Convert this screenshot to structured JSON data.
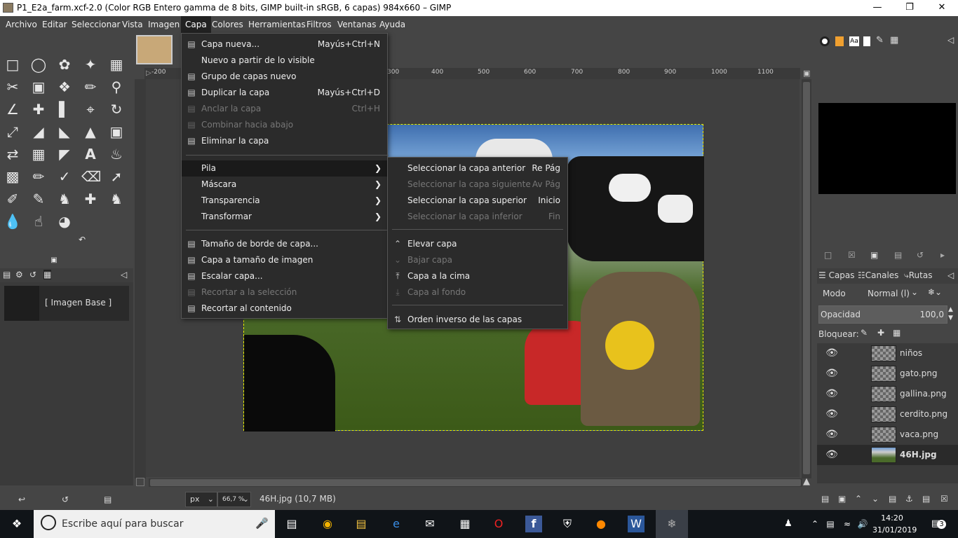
{
  "window": {
    "title": "P1_E2a_farm.xcf-2.0 (Color RGB Entero gamma de 8 bits, GIMP built-in sRGB, 6 capas) 984x660 – GIMP"
  },
  "menubar": [
    "Archivo",
    "Editar",
    "Seleccionar",
    "Vista",
    "Imagen",
    "Capa",
    "Colores",
    "Herramientas",
    "Filtros",
    "Ventanas",
    "Ayuda"
  ],
  "capa_menu": {
    "items": [
      {
        "label": "Capa nueva...",
        "shortcut": "Mayús+Ctrl+N",
        "icon": "new-layer-icon",
        "disabled": false
      },
      {
        "label": "Nuevo a partir de lo visible",
        "shortcut": "",
        "icon": "",
        "disabled": false
      },
      {
        "label": "Grupo de capas nuevo",
        "shortcut": "",
        "icon": "layer-group-icon",
        "disabled": false
      },
      {
        "label": "Duplicar la capa",
        "shortcut": "Mayús+Ctrl+D",
        "icon": "duplicate-icon",
        "disabled": false
      },
      {
        "label": "Anclar la capa",
        "shortcut": "Ctrl+H",
        "icon": "anchor-icon",
        "disabled": true
      },
      {
        "label": "Combinar hacia abajo",
        "shortcut": "",
        "icon": "merge-down-icon",
        "disabled": true
      },
      {
        "label": "Eliminar la capa",
        "shortcut": "",
        "icon": "delete-icon",
        "disabled": false
      },
      {
        "label": "Pila",
        "shortcut": "",
        "icon": "",
        "disabled": false,
        "submenu": true
      },
      {
        "label": "Máscara",
        "shortcut": "",
        "icon": "",
        "disabled": false,
        "submenu": true
      },
      {
        "label": "Transparencia",
        "shortcut": "",
        "icon": "",
        "disabled": false,
        "submenu": true
      },
      {
        "label": "Transformar",
        "shortcut": "",
        "icon": "",
        "disabled": false,
        "submenu": true
      },
      {
        "label": "Tamaño de borde de capa...",
        "shortcut": "",
        "icon": "boundary-icon",
        "disabled": false
      },
      {
        "label": "Capa a tamaño de imagen",
        "shortcut": "",
        "icon": "layer-to-image-icon",
        "disabled": false
      },
      {
        "label": "Escalar capa...",
        "shortcut": "",
        "icon": "scale-icon",
        "disabled": false
      },
      {
        "label": "Recortar a la selección",
        "shortcut": "",
        "icon": "crop-icon",
        "disabled": true
      },
      {
        "label": "Recortar al contenido",
        "shortcut": "",
        "icon": "crop-content-icon",
        "disabled": false
      }
    ]
  },
  "pila_menu": {
    "items": [
      {
        "label": "Seleccionar la capa anterior",
        "shortcut": "Re Pág",
        "icon": "",
        "disabled": false
      },
      {
        "label": "Seleccionar la capa siguiente",
        "shortcut": "Av Pág",
        "icon": "",
        "disabled": true
      },
      {
        "label": "Seleccionar la capa superior",
        "shortcut": "Inicio",
        "icon": "",
        "disabled": false
      },
      {
        "label": "Seleccionar la capa inferior",
        "shortcut": "Fin",
        "icon": "",
        "disabled": true
      },
      {
        "label": "Elevar capa",
        "shortcut": "",
        "icon": "raise-icon",
        "disabled": false
      },
      {
        "label": "Bajar capa",
        "shortcut": "",
        "icon": "lower-icon",
        "disabled": true
      },
      {
        "label": "Capa a la cima",
        "shortcut": "",
        "icon": "to-top-icon",
        "disabled": false
      },
      {
        "label": "Capa al fondo",
        "shortcut": "",
        "icon": "to-bottom-icon",
        "disabled": true
      },
      {
        "label": "Orden inverso de las capas",
        "shortcut": "",
        "icon": "reverse-icon",
        "disabled": false
      }
    ]
  },
  "ruler": [
    "-200",
    "300",
    "400",
    "500",
    "600",
    "700",
    "800",
    "900",
    "1000",
    "1100"
  ],
  "images_panel": {
    "item": "[ Imagen Base ]"
  },
  "status": {
    "unit": "px",
    "zoom": "66,7 %",
    "text": "46H.jpg (10,7 MB)"
  },
  "layers_dock": {
    "tabs": [
      "Capas",
      "Canales",
      "Rutas"
    ],
    "mode_label": "Modo",
    "mode_value": "Normal (l)",
    "opacity_label": "Opacidad",
    "opacity_value": "100,0",
    "lock_label": "Bloquear:",
    "layers": [
      {
        "name": "niños",
        "selected": false
      },
      {
        "name": "gato.png",
        "selected": false
      },
      {
        "name": "gallina.png",
        "selected": false
      },
      {
        "name": "cerdito.png",
        "selected": false
      },
      {
        "name": "vaca.png",
        "selected": false
      },
      {
        "name": "46H.jpg",
        "selected": true
      }
    ]
  },
  "taskbar": {
    "search_placeholder": "Escribe aquí para buscar",
    "time": "14:20",
    "date": "31/01/2019",
    "notifications": "3"
  }
}
